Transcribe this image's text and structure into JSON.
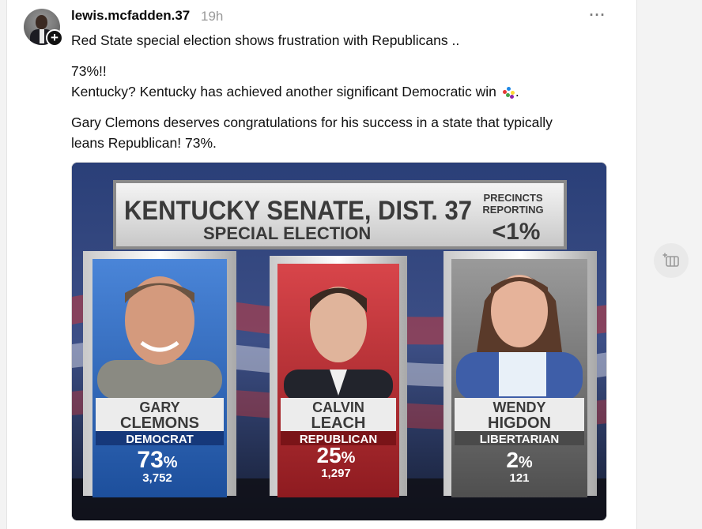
{
  "post": {
    "username": "lewis.mcfadden.37",
    "timestamp": "19h",
    "more_label": "···",
    "follow_label": "+",
    "text": {
      "line1": "Red State special election shows frustration with Republicans ..",
      "line2": "73%!!",
      "line3": "Kentucky? Kentucky has achieved another significant Democratic win",
      "line3_end": ".",
      "line4": "Gary Clemons deserves congratulations for his success in a state that typically",
      "line5": "leans Republican! 73%."
    }
  },
  "graphic": {
    "title": "KENTUCKY SENATE, DIST. 37",
    "subtitle": "SPECIAL ELECTION",
    "precincts_label_1": "PRECINCTS",
    "precincts_label_2": "REPORTING",
    "precincts_value": "<1%",
    "candidates": [
      {
        "first": "GARY",
        "last": "CLEMONS",
        "party": "DEMOCRAT",
        "percent": "73",
        "votes": "3,752"
      },
      {
        "first": "CALVIN",
        "last": "LEACH",
        "party": "REPUBLICAN",
        "percent": "25",
        "votes": "1,297"
      },
      {
        "first": "WENDY",
        "last": "HIGDON",
        "party": "LIBERTARIAN",
        "percent": "2",
        "votes": "121"
      }
    ],
    "percent_sign": "%",
    "colors": {
      "democrat": "#2a63b8",
      "republican": "#b2232a",
      "libertarian": "#6b6b6b"
    }
  }
}
